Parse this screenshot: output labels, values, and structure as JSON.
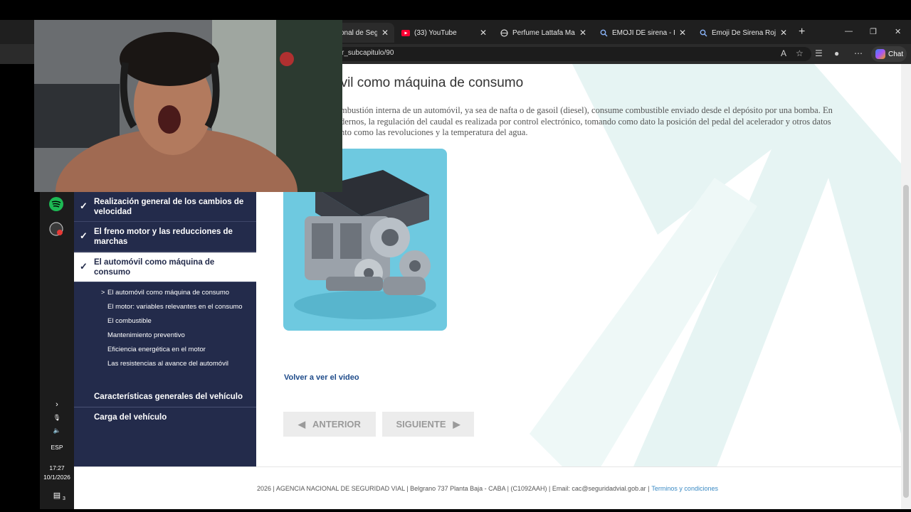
{
  "browser": {
    "tabs": [
      {
        "title": "onal de Seg",
        "active": true,
        "favicon": "site-icon"
      },
      {
        "title": "(33) YouTube",
        "active": false,
        "favicon": "youtube-icon"
      },
      {
        "title": "Perfume Lattafa Marrón",
        "active": false,
        "favicon": "globe-icon"
      },
      {
        "title": "EMOJI DE sirena - Búsq",
        "active": false,
        "favicon": "search-icon"
      },
      {
        "title": "Emoji De Sirena Roja - B",
        "active": false,
        "favicon": "search-icon"
      }
    ],
    "url": "r_subcapitulo/90",
    "chat_label": "Chat"
  },
  "page": {
    "title": "óvil como máquina de consumo",
    "paragraph_lines": [
      "mbustión interna de un automóvil, ya sea de nafta o de gasoil (diesel), consume combustible enviado desde el depósito por una bomba. En",
      "dernos, la regulación del caudal es realizada por control electrónico, tomando como dato la posición del pedal del acelerador y otros datos",
      "nto como las revoluciones y la temperatura del agua."
    ],
    "video_link": "Volver a ver el video",
    "prev_label": "ANTERIOR",
    "next_label": "SIGUIENTE"
  },
  "sidebar": {
    "chapters": [
      {
        "label": "Realización general de los cambios de velocidad",
        "checked": true,
        "active": false
      },
      {
        "label": "El freno motor y las reducciones de marchas",
        "checked": true,
        "active": false
      },
      {
        "label": "El automóvil como máquina de consumo",
        "checked": true,
        "active": true
      }
    ],
    "subitems": [
      "El automóvil como máquina de consumo",
      "El motor: variables relevantes en el consumo",
      "El combustible",
      "Mantenimiento preventivo",
      "Eficiencia energética en el motor",
      "Las resistencias al avance del automóvil"
    ],
    "sections": [
      "Características generales del vehículo",
      "Carga del vehículo"
    ]
  },
  "footer": {
    "text": "2026 | AGENCIA NACIONAL DE SEGURIDAD VIAL | Belgrano 737 Planta Baja - CABA | (C1092AAH) | Email: cac@seguridadvial.gob.ar |",
    "terms": "Terminos y condiciones"
  },
  "taskbar": {
    "language": "ESP",
    "time": "17:27",
    "date": "10/1/2026",
    "notifications": "3"
  },
  "colors": {
    "sidebar": "#232b4b",
    "link": "#1e4b8a",
    "engine_bg": "#6ec9e0"
  }
}
